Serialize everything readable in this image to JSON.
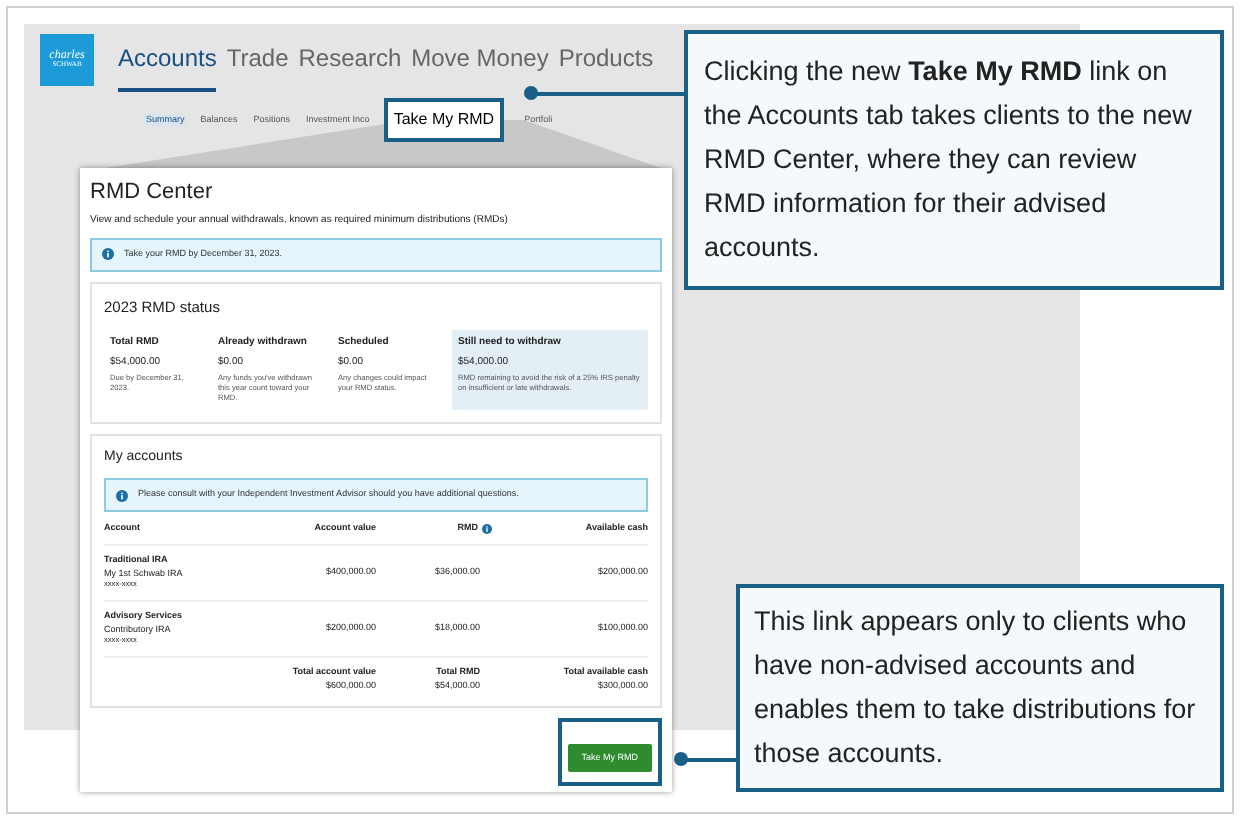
{
  "site": {
    "logo": [
      "charles",
      "SCHWAB"
    ],
    "nav": [
      {
        "label": "Accounts",
        "selected": true
      },
      {
        "label": "Trade",
        "selected": false
      },
      {
        "label": "Research",
        "selected": false
      },
      {
        "label": "Move Money",
        "selected": false
      },
      {
        "label": "Products",
        "selected": false
      }
    ],
    "subnav": [
      {
        "label": "Summary",
        "selected": true,
        "highlighted": false
      },
      {
        "label": "Balances",
        "selected": false,
        "highlighted": false
      },
      {
        "label": "Positions",
        "selected": false,
        "highlighted": false
      },
      {
        "label": "Investment Inco",
        "selected": false,
        "highlighted": false
      },
      {
        "label": "Take My RMD",
        "selected": false,
        "highlighted": true
      },
      {
        "label": "Portfoli",
        "selected": false,
        "highlighted": false
      }
    ]
  },
  "rmd_center": {
    "title": "RMD Center",
    "subtitle": "View and schedule your annual withdrawals, known as required minimum distributions (RMDs)",
    "alert": "Take your RMD by December 31, 2023.",
    "status": {
      "title": "2023 RMD status",
      "columns": [
        {
          "label": "Total RMD",
          "amount": "$54,000.00",
          "note": "Due by December 31, 2023.",
          "highlighted": false
        },
        {
          "label": "Already withdrawn",
          "amount": "$0.00",
          "note": "Any funds you've withdrawn this year count toward your RMD.",
          "highlighted": false
        },
        {
          "label": "Scheduled",
          "amount": "$0.00",
          "note": "Any changes could impact your RMD status.",
          "highlighted": false
        },
        {
          "label": "Still need to withdraw",
          "amount": "$54,000.00",
          "note": "RMD remaining to avoid the risk of a 25% IRS penalty on insufficient or late withdrawals.",
          "highlighted": true
        }
      ]
    },
    "accounts": {
      "title": "My accounts",
      "alert": "Please consult with your Independent Investment Advisor should you have additional questions.",
      "columns": [
        "Account",
        "Account value",
        "RMD",
        "Available cash"
      ],
      "rows": [
        {
          "name": "Traditional IRA",
          "subname": "My 1st Schwab IRA",
          "number": "xxxx-xxxx",
          "value": "$400,000.00",
          "rmd": "$36,000.00",
          "cash": "$200,000.00"
        },
        {
          "name": "Advisory Services",
          "subname": "Contributory IRA",
          "number": "xxxx-xxxx",
          "value": "$200,000.00",
          "rmd": "$18,000.00",
          "cash": "$100,000.00"
        }
      ],
      "totals": [
        {
          "label": "Total account value",
          "value": "$600,000.00"
        },
        {
          "label": "Total RMD",
          "value": "$54,000.00"
        },
        {
          "label": "Total available cash",
          "value": "$300,000.00"
        }
      ]
    },
    "button": "Take My RMD"
  },
  "callouts": [
    "Clicking the new **Take My RMD** link on the Accounts tab takes clients to the new RMD Center, where they can review RMD information for their advised accounts.",
    "This link appears only to clients who have non-advised accounts and enables them to take distributions for those accounts."
  ]
}
